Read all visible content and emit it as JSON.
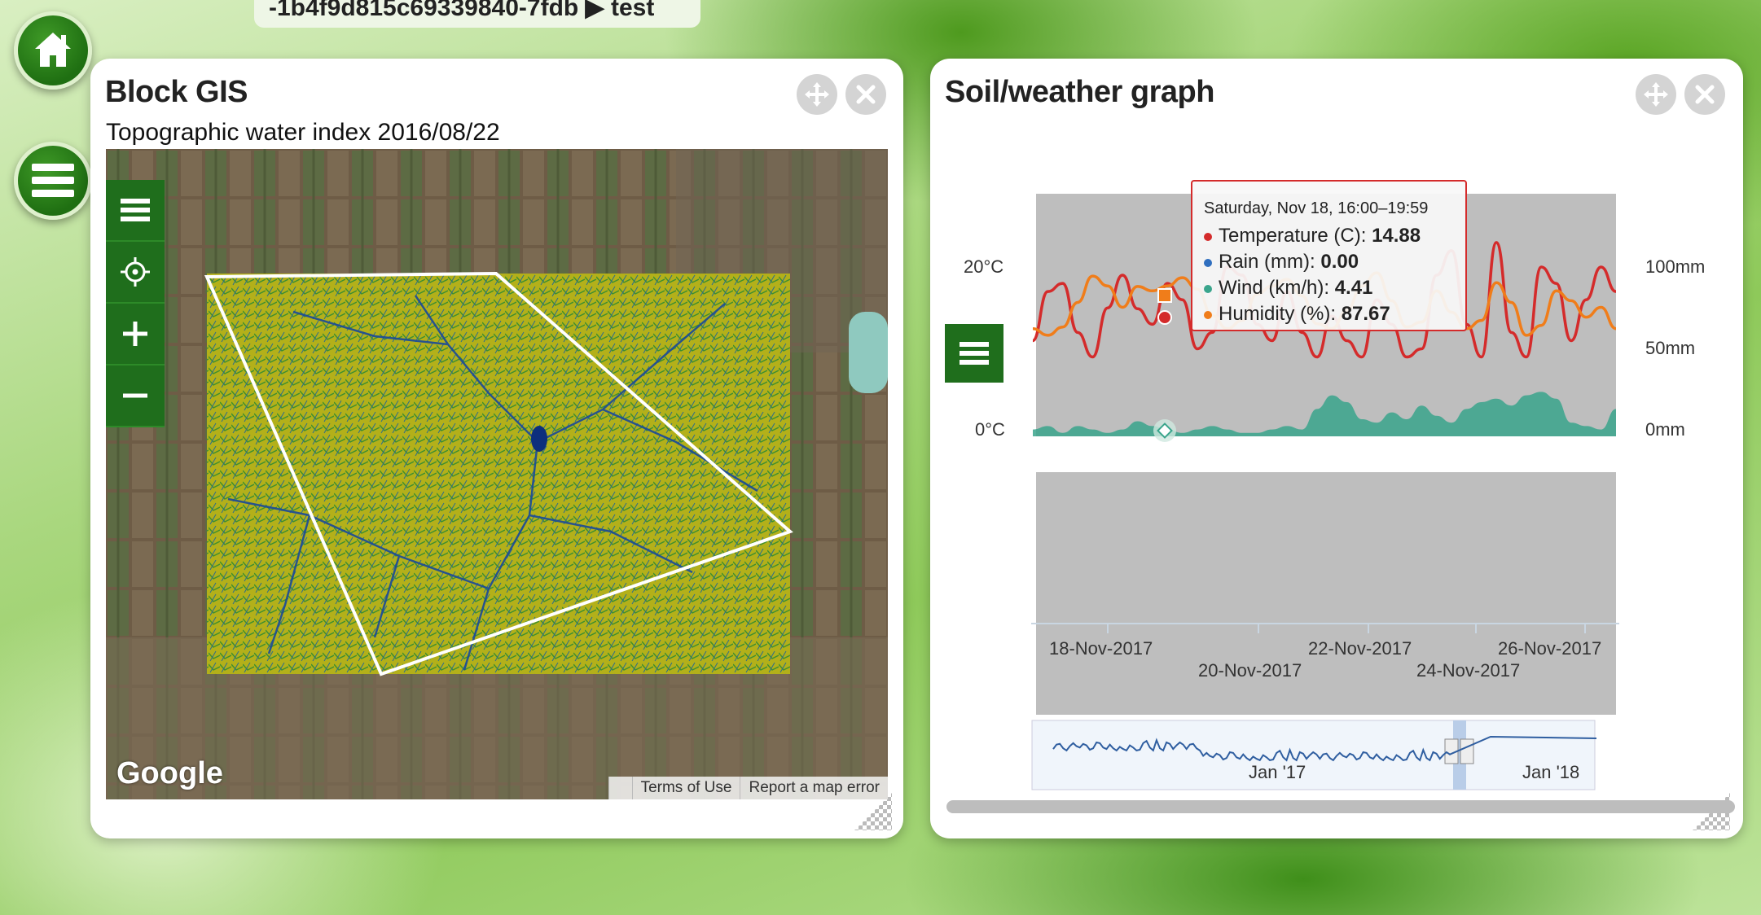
{
  "top_bar": {
    "text": "-1b4f9d815c69339840-7fdb ▶ test"
  },
  "nav": {
    "home_icon": "home-icon",
    "menu_icon": "hamburger-icon"
  },
  "gis_panel": {
    "title": "Block GIS",
    "subtitle": "Topographic water index 2016/08/22",
    "move_icon": "move-icon",
    "close_icon": "close-icon",
    "map": {
      "tools": [
        "layers-menu",
        "locate",
        "zoom-in",
        "zoom-out"
      ],
      "logo": "Google",
      "terms": "Terms of Use",
      "report": "Report a map error"
    }
  },
  "graph_panel": {
    "title": "Soil/weather graph",
    "move_icon": "move-icon",
    "close_icon": "close-icon",
    "menu_icon": "hamburger-icon",
    "tooltip": {
      "header": "Saturday, Nov 18, 16:00–19:59",
      "rows": [
        {
          "label": "Temperature (C): ",
          "value": "14.88",
          "color": "#d42b2b"
        },
        {
          "label": "Rain (mm): ",
          "value": "0.00",
          "color": "#2f6fbf"
        },
        {
          "label": "Wind (km/h): ",
          "value": "4.41",
          "color": "#3aa58c"
        },
        {
          "label": "Humidity (%): ",
          "value": "87.67",
          "color": "#f07d1a"
        }
      ]
    },
    "navigator": {
      "labels": [
        "Jan '17",
        "Jan '18"
      ]
    }
  },
  "chart_data": {
    "type": "line",
    "title": "",
    "y_left_ticks": [
      "20°C",
      "0°C"
    ],
    "y_right_ticks": [
      "100mm",
      "50mm",
      "0mm"
    ],
    "x_ticks": [
      "18-Nov-2017",
      "20-Nov-2017",
      "22-Nov-2017",
      "24-Nov-2017",
      "26-Nov-2017"
    ],
    "x_ticks_top_row": [
      "18-Nov-2017",
      "22-Nov-2017",
      "26-Nov-2017"
    ],
    "x_ticks_bottom_row": [
      "20-Nov-2017",
      "24-Nov-2017"
    ],
    "series": [
      {
        "name": "Temperature (C)",
        "color": "#d42b2b",
        "values": [
          11,
          17,
          18,
          12,
          9,
          15,
          19,
          14.9,
          13,
          18,
          16,
          10,
          12,
          20,
          19,
          13,
          11,
          17,
          12,
          9,
          14,
          11,
          9,
          16,
          13,
          9,
          10,
          19,
          22,
          13,
          9,
          23,
          12,
          9,
          20,
          18,
          11,
          16,
          20,
          17
        ]
      },
      {
        "name": "Rain (mm)",
        "color": "#2f6fbf",
        "values": []
      },
      {
        "name": "Wind (km/h)",
        "color": "#3aa58c",
        "values": [
          2,
          3,
          1,
          3,
          2,
          1,
          2,
          4.4,
          3,
          2,
          1,
          2,
          3,
          2,
          1,
          1,
          2,
          3,
          2,
          8,
          12,
          10,
          5,
          4,
          7,
          5,
          9,
          6,
          4,
          8,
          10,
          11,
          9,
          12,
          13,
          11,
          4,
          3,
          2,
          8
        ]
      },
      {
        "name": "Humidity (%)",
        "color": "#f07d1a",
        "values": [
          62,
          58,
          63,
          78,
          94,
          88,
          75,
          87.7,
          85,
          88,
          93,
          86,
          70,
          62,
          67,
          83,
          88,
          92,
          82,
          65,
          62,
          73,
          88,
          96,
          79,
          63,
          66,
          85,
          72,
          62,
          67,
          90,
          78,
          58,
          64,
          85,
          79,
          69,
          75,
          62
        ]
      }
    ],
    "grid": false
  }
}
